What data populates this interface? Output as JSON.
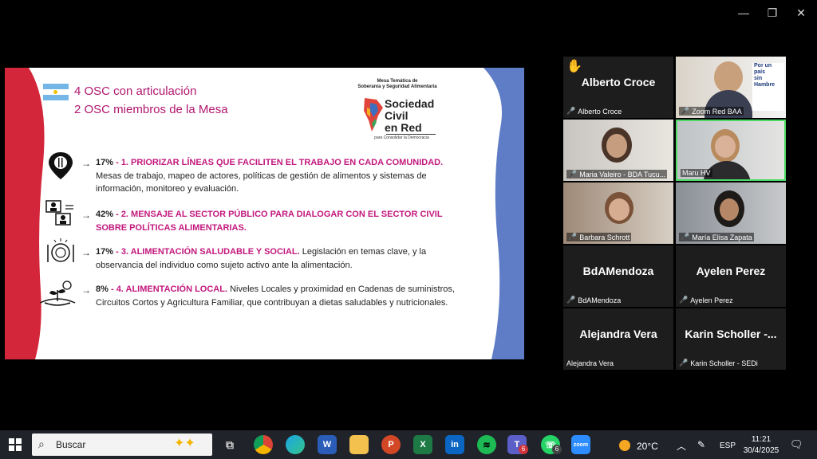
{
  "slide": {
    "title_line1": "4 OSC con articulación",
    "title_line2": "2 OSC miembros de la Mesa",
    "logo_small_1": "Mesa Temática de",
    "logo_small_2": "Soberanía y Seguridad Alimentaria",
    "logo_main_1": "Sociedad",
    "logo_main_2": "Civil",
    "logo_main_3": "en Red",
    "logo_sub": "para Consolidar la Democracia",
    "items": [
      {
        "arrow": "→",
        "pct": "17%",
        "sep": " - ",
        "head": "1. PRIORIZAR LÍNEAS QUE FACILITEN EL TRABAJO EN CADA COMUNIDAD.",
        "body": " Mesas de trabajo, mapeo de actores, políticas de gestión de alimentos y sistemas de información, monitoreo y evaluación."
      },
      {
        "arrow": "→",
        "pct": "42%",
        "sep": " - ",
        "head": "2. MENSAJE AL SECTOR PÚBLICO PARA DIALOGAR CON EL SECTOR CIVIL SOBRE POLÍTICAS ALIMENTARIAS.",
        "body": ""
      },
      {
        "arrow": "→",
        "pct": "17%",
        "sep": " - ",
        "head": "3. ALIMENTACIÓN SALUDABLE Y SOCIAL.",
        "body": " Legislación en temas clave, y la observancia del individuo como sujeto activo ante la alimentación."
      },
      {
        "arrow": "→",
        "pct": "8%",
        "sep": " - ",
        "head": "4. ALIMENTACIÓN LOCAL.",
        "body": " Niveles Locales y proximidad en Cadenas de suministros, Circuitos Cortos y Agricultura Familiar, que contribuyan a dietas saludables y nutricionales."
      }
    ]
  },
  "participants": [
    {
      "name": "Alberto Croce",
      "label": "Alberto Croce",
      "video": false,
      "raised_hand": true,
      "muted": true
    },
    {
      "name": "",
      "label": "Zoom Red BAA",
      "video": true,
      "muted": true
    },
    {
      "name": "",
      "label": "Maria Valeiro - BDA Tucu...",
      "video": true,
      "muted": true
    },
    {
      "name": "",
      "label": "Maru HV",
      "video": true,
      "muted": false,
      "active": true
    },
    {
      "name": "",
      "label": "Barbara Schrott",
      "video": true,
      "muted": true
    },
    {
      "name": "",
      "label": "María Elisa Zapata",
      "video": true,
      "muted": true
    },
    {
      "name": "BdAMendoza",
      "label": "BdAMendoza",
      "video": false,
      "muted": true
    },
    {
      "name": "Ayelen Perez",
      "label": "Ayelen Perez",
      "video": false,
      "muted": true
    },
    {
      "name": "Alejandra Vera",
      "label": "Alejandra Vera",
      "video": false,
      "muted": false
    },
    {
      "name": "Karin  Scholler -...",
      "label": "Karin Scholler - SEDi",
      "video": false,
      "muted": true
    }
  ],
  "zoom_banner": {
    "line1": "Por un",
    "line2": "país",
    "line3": "sin",
    "line4": "Hambre"
  },
  "taskbar": {
    "search_placeholder": "Buscar",
    "weather": "20°C",
    "language": "ESP",
    "time": "11:21",
    "date": "30/4/2025",
    "teams_badge": "6",
    "whatsapp_badge": "6"
  },
  "colors": {
    "accent_magenta": "#c2187d",
    "active_border": "#4cd964",
    "taskbar": "#20232a"
  }
}
